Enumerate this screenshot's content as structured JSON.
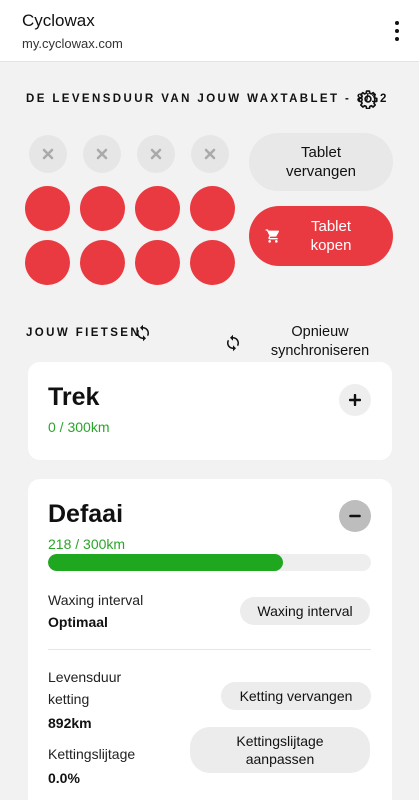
{
  "appbar": {
    "title": "Cyclowax",
    "url": "my.cyclowax.com"
  },
  "tablet": {
    "heading": "DE LEVENSDUUR VAN JOUW WAXTABLET - 8/12",
    "used_count": 4,
    "full_count": 8,
    "replace_label": "Tablet vervangen",
    "buy_label": "Tablet kopen"
  },
  "bikes_section": {
    "heading": "JOUW FIETSEN",
    "sync_label": "Opnieuw synchroniseren"
  },
  "bikes": [
    {
      "name": "Trek",
      "km": "0 / 300km"
    },
    {
      "name": "Defaai",
      "km": "218 / 300km",
      "progress": 0.727,
      "waxing_interval_label": "Waxing interval",
      "waxing_interval_value": "Optimaal",
      "waxing_interval_button": "Waxing interval",
      "chain_life_label": "Levensduur ketting",
      "chain_life_value": "892km",
      "chain_replace_button": "Ketting vervangen",
      "chain_wear_label": "Kettingslijtage",
      "chain_wear_value": "0.0%",
      "chain_wear_button": "Kettingslijtage aanpassen"
    }
  ],
  "colors": {
    "accent": "#ea3a41",
    "progress": "#1fa81f",
    "km_text": "#2aa52a"
  }
}
